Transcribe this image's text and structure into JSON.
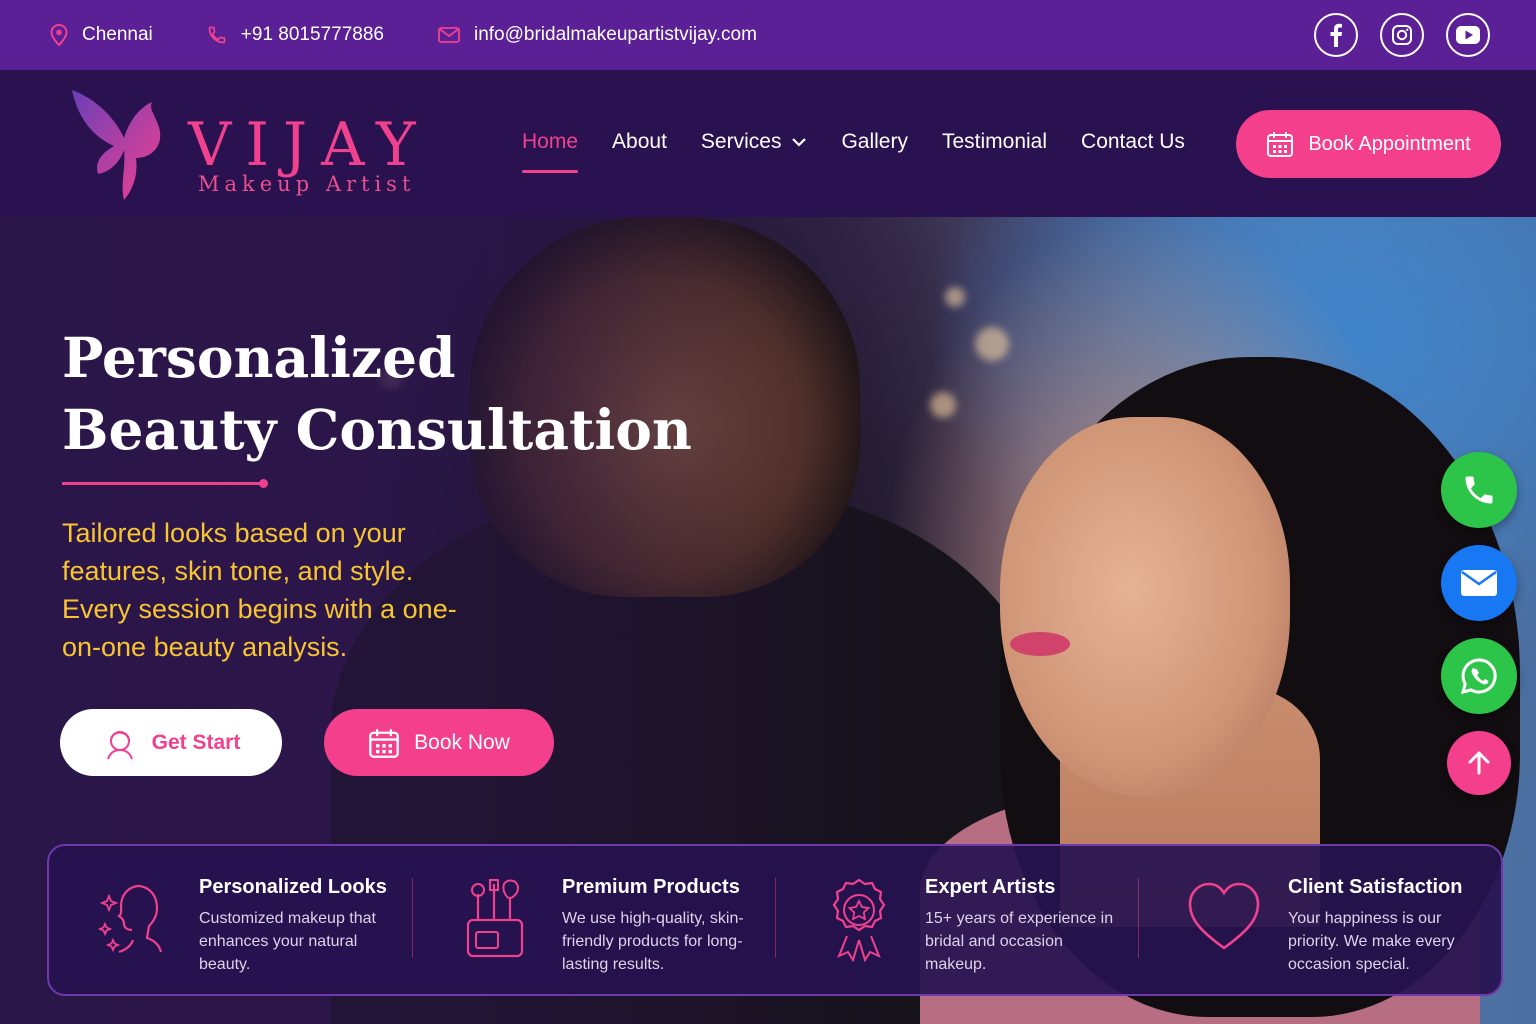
{
  "topbar": {
    "location": "Chennai",
    "phone": "+91 8015777886",
    "email": "info@bridalmakeupartistvijay.com",
    "socials": [
      "facebook-icon",
      "instagram-icon",
      "youtube-icon"
    ]
  },
  "brand": {
    "title": "VIJAY",
    "subtitle": "Makeup Artist"
  },
  "nav": {
    "items": [
      {
        "label": "Home",
        "active": true
      },
      {
        "label": "About"
      },
      {
        "label": "Services",
        "has_dropdown": true
      },
      {
        "label": "Gallery"
      },
      {
        "label": "Testimonial"
      },
      {
        "label": "Contact Us"
      }
    ],
    "cta": "Book Appointment"
  },
  "hero": {
    "title_line1": "Personalized",
    "title_line2": "Beauty Consultation",
    "description": "Tailored looks based on your features, skin tone, and style. Every session begins with a one-on-one beauty analysis.",
    "primary_button": "Get Start",
    "secondary_button": "Book Now"
  },
  "features": [
    {
      "icon": "woman-face-icon",
      "title": "Personalized Looks",
      "text": "Customized makeup that enhances your natural beauty."
    },
    {
      "icon": "brushes-icon",
      "title": "Premium Products",
      "text": "We use high-quality, skin-friendly products for long-lasting results."
    },
    {
      "icon": "award-badge-icon",
      "title": "Expert Artists",
      "text": "15+ years of experience in bridal and occasion makeup."
    },
    {
      "icon": "heart-icon",
      "title": "Client Satisfaction",
      "text": "Your happiness is our priority. We make every occasion special."
    }
  ],
  "floating": [
    "phone-icon",
    "mail-icon",
    "whatsapp-icon",
    "arrow-up-icon"
  ],
  "colors": {
    "accent": "#f43f8d",
    "topbar": "#5b1f96",
    "nav": "#2a1150",
    "highlight": "#f7c531",
    "call": "#2cc54a",
    "mail": "#1877f2"
  }
}
